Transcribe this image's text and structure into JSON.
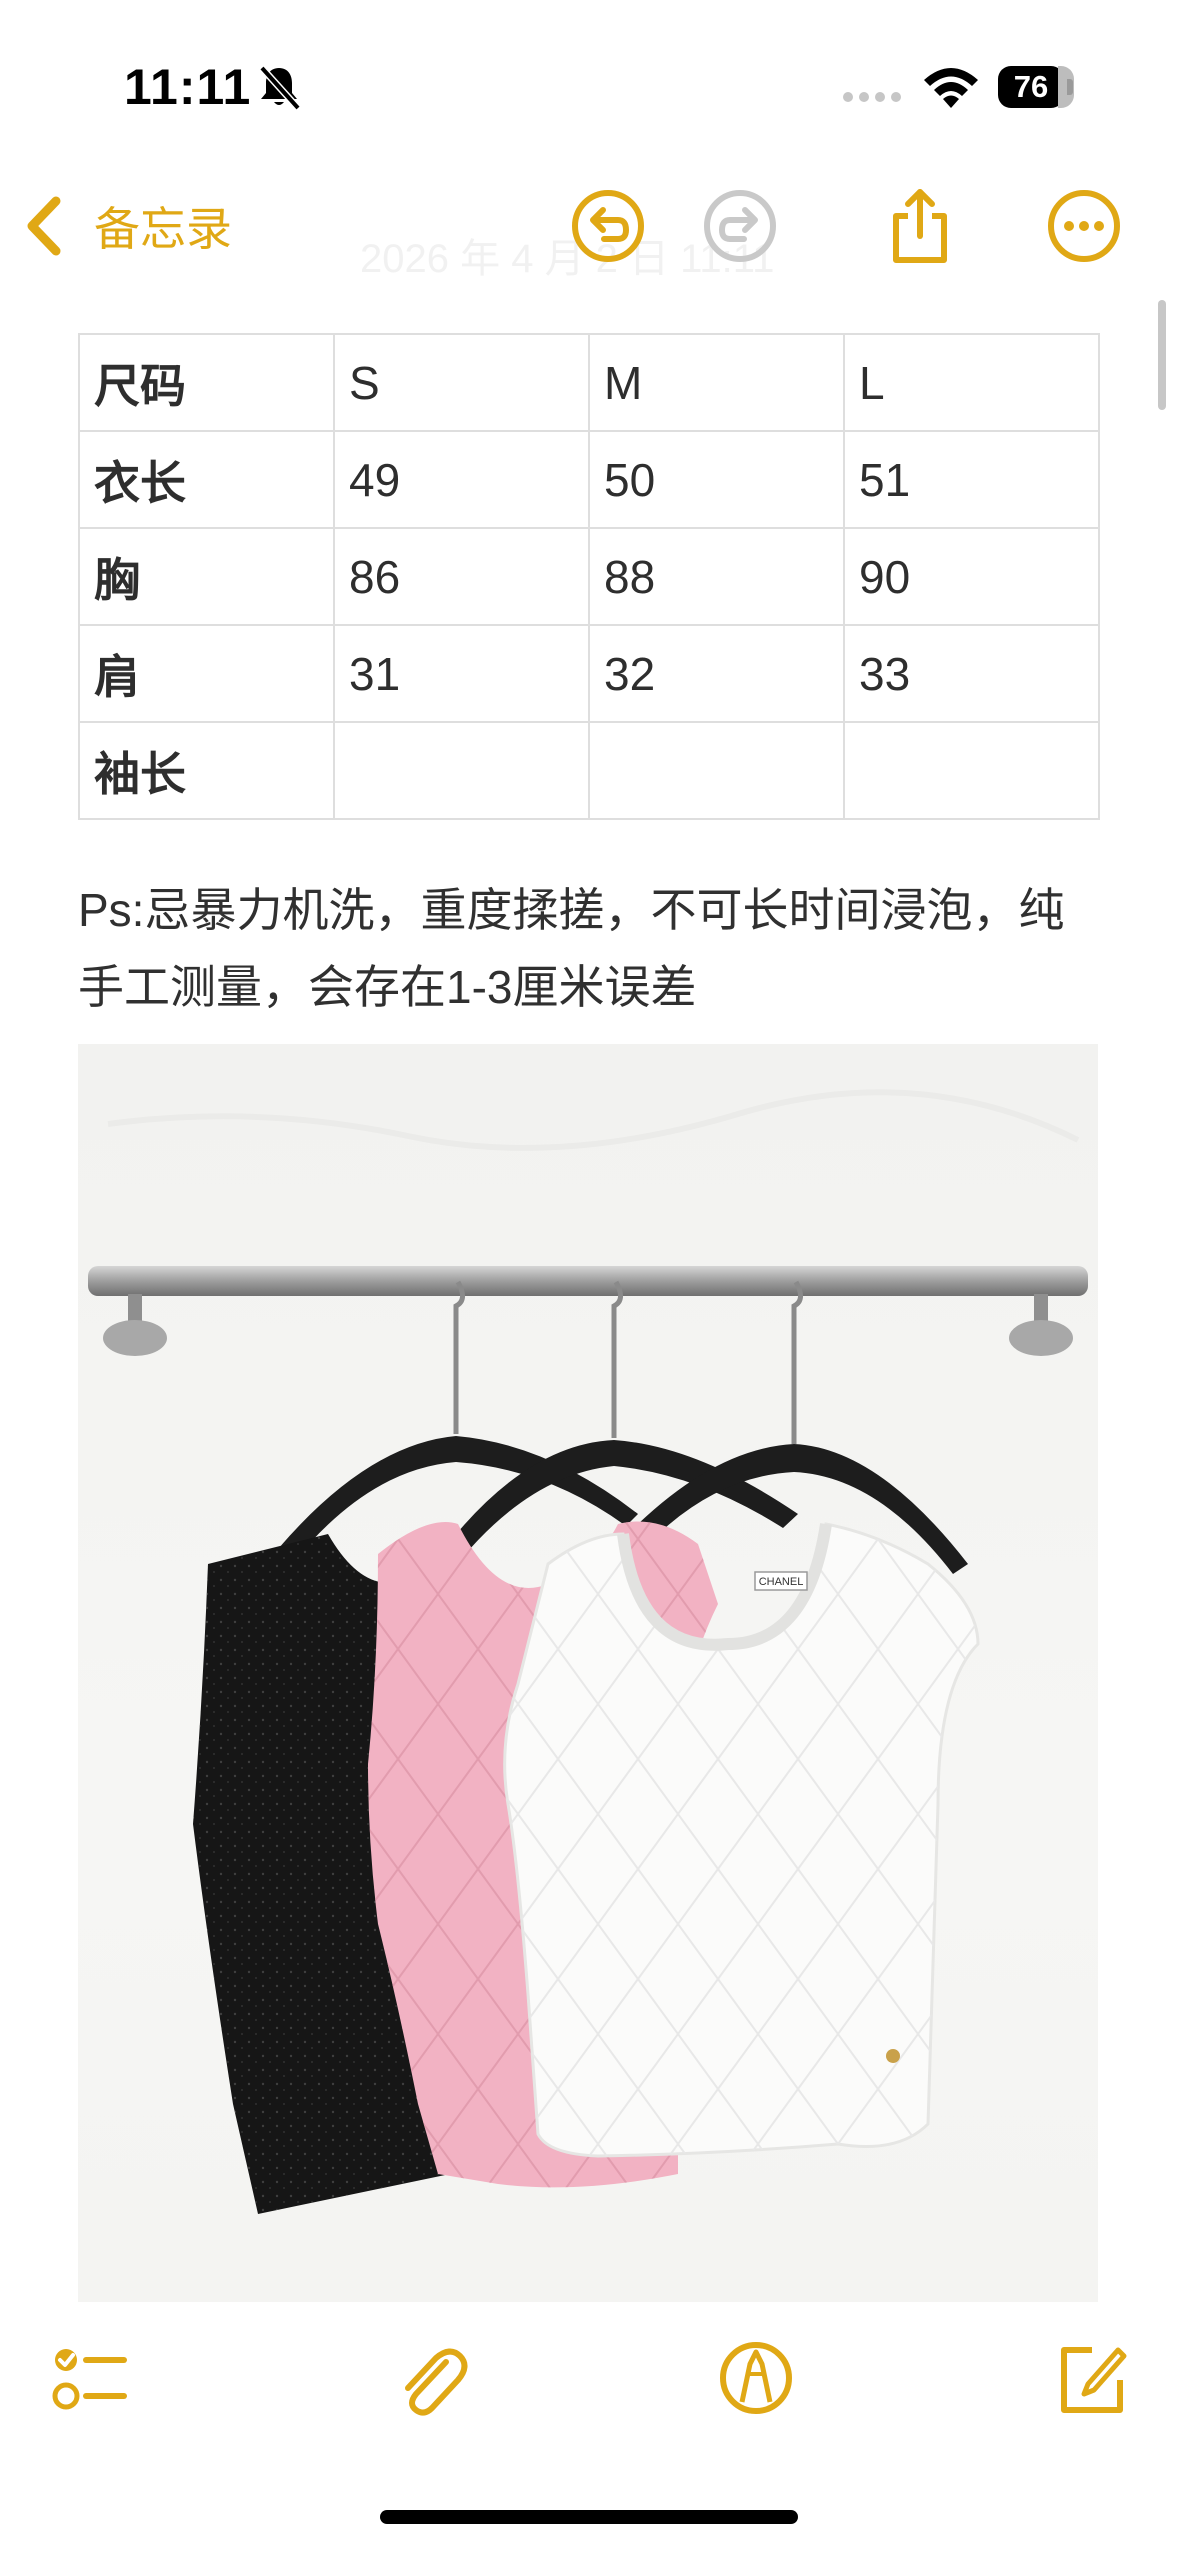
{
  "status_bar": {
    "time": "11:11",
    "battery_percent": "76",
    "battery_level": 0.76
  },
  "nav": {
    "back_label": "备忘录",
    "ghost_date": "2026 年 4 月 2 日 11:11"
  },
  "size_table": {
    "rows": [
      [
        "尺码",
        "S",
        "M",
        "L"
      ],
      [
        "衣长",
        "49",
        "50",
        "51"
      ],
      [
        "胸",
        "86",
        "88",
        "90"
      ],
      [
        "肩",
        "31",
        "32",
        "33"
      ],
      [
        "袖长",
        "",
        "",
        ""
      ]
    ]
  },
  "note_text": "Ps:忌暴力机洗，重度揉搓，不可长时间浸泡，纯手工测量，会存在1-3厘米误差",
  "photo": {
    "label_text": "CHANEL"
  },
  "colors": {
    "accent": "#e0a815",
    "background": "#ffffff",
    "text": "#2b2b2b"
  },
  "icons": {
    "back": "chevron-left-icon",
    "undo": "undo-icon",
    "redo": "redo-icon",
    "share": "share-icon",
    "more": "ellipsis-icon",
    "checklist": "checklist-icon",
    "attach": "paperclip-icon",
    "markup": "pen-icon",
    "compose": "compose-icon"
  }
}
